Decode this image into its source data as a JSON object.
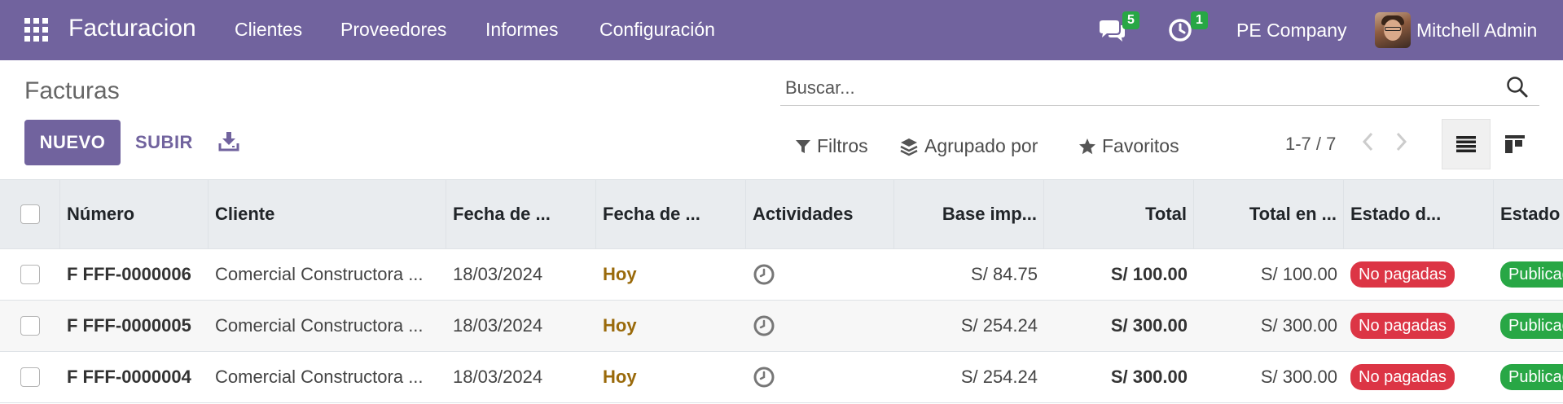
{
  "navbar": {
    "app_name": "Facturacion",
    "menu": [
      "Clientes",
      "Proveedores",
      "Informes",
      "Configuración"
    ],
    "messages_count": "5",
    "activities_count": "1",
    "company": "PE Company",
    "user": "Mitchell Admin",
    "icons": [
      "apps-grid-icon",
      "chat-icon",
      "clock-icon"
    ],
    "colors": {
      "brand": "#71639e",
      "badge": "#28a745"
    }
  },
  "control_panel": {
    "title": "Facturas",
    "search_placeholder": "Buscar...",
    "new_label": "NUEVO",
    "upload_label": "SUBIR",
    "filters_label": "Filtros",
    "group_by_label": "Agrupado por",
    "favorites_label": "Favoritos",
    "pager": "1-7 / 7"
  },
  "table": {
    "headers": [
      "Número",
      "Cliente",
      "Fecha de ...",
      "Fecha de ...",
      "Actividades",
      "Base imp...",
      "Total",
      "Total en ...",
      "Estado d...",
      "Estado"
    ],
    "rows": [
      {
        "numero": "F FFF-0000006",
        "cliente": "Comercial Constructora ...",
        "fecha_factura": "18/03/2024",
        "fecha_vencimiento": "Hoy",
        "base": "S/ 84.75",
        "total": "S/ 100.00",
        "total_moneda": "S/ 100.00",
        "estado_pago": "No pagadas",
        "estado": "Publicado"
      },
      {
        "numero": "F FFF-0000005",
        "cliente": "Comercial Constructora ...",
        "fecha_factura": "18/03/2024",
        "fecha_vencimiento": "Hoy",
        "base": "S/ 254.24",
        "total": "S/ 300.00",
        "total_moneda": "S/ 300.00",
        "estado_pago": "No pagadas",
        "estado": "Publicado"
      },
      {
        "numero": "F FFF-0000004",
        "cliente": "Comercial Constructora ...",
        "fecha_factura": "18/03/2024",
        "fecha_vencimiento": "Hoy",
        "base": "S/ 254.24",
        "total": "S/ 300.00",
        "total_moneda": "S/ 300.00",
        "estado_pago": "No pagadas",
        "estado": "Publicado"
      }
    ],
    "colors": {
      "not_paid": "#dc3545",
      "posted": "#28a745",
      "today": "#9a6a0b"
    }
  }
}
